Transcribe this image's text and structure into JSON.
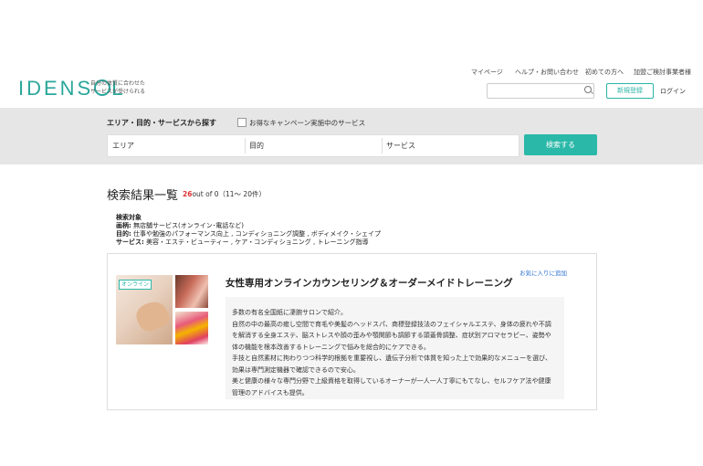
{
  "header": {
    "logo_text_left": "IDENS",
    "logo_text_right": "L",
    "tagline_line1": "自分の体質に合わせた",
    "tagline_line2": "サービスが受けられる",
    "nav": [
      "マイページ",
      "ヘルプ・お問い合わせ",
      "初めての方へ",
      "加盟ご検討事業者様"
    ],
    "search_placeholder": "",
    "register_label": "新規登録",
    "login_label": "ログイン"
  },
  "search": {
    "title": "エリア・目的・サービスから探す",
    "campaign_label": "お得なキャンペーン実施中のサービス",
    "fields": [
      "エリア",
      "目的",
      "サービス"
    ],
    "button_label": "検索する"
  },
  "results": {
    "title": "検索結果一覧",
    "count_number": "26",
    "count_suffix": "out of 0（11〜 20件）",
    "target_heading": "検索対象",
    "target_lines": [
      {
        "label": "画柄:",
        "value": " 無店舗サービス(オンライン･電話など)"
      },
      {
        "label": "目的:",
        "value": " 仕事や勉強のパフォーマンス向上 , コンディショニング調整 , ボディメイク・シェイプ"
      },
      {
        "label": "サービス:",
        "value": " 美容・エステ・ビューティー , ケア・コンディショニング , トレーニング指導"
      }
    ]
  },
  "card": {
    "favorite_label": "お気に入りに追加",
    "badge": "オンライン",
    "title": "女性専用オンラインカウンセリング＆オーダーメイドトレーニング",
    "description": [
      "多数の有名全国紙に凄腕サロンで紹介。",
      "自然の中の最高の癒し空間で育毛や美髪のヘッドスパ、商標登録技法のフェイシャルエステ、身体の疲れや不調",
      "を解消する全身エステ、脳ストレスや顔の歪みや顎関節も調節する頭蓋骨調整、症状別アロマセラピー、姿勢や",
      "体の機能を根本改善するトレーニングで悩みを総合的にケアできる。",
      "手技と自然素材に拘わりつつ科学的根拠を重要視し、遺伝子分析で体質を知った上で効果的なメニューを選び、",
      "効果は専門測定機器で確認できるので安心。",
      "美と健康の様々な専門分野で上級資格を取得しているオーナーが一人一人丁寧にもてなし、セルフケア法や健康",
      "管理のアドバイスも提供。"
    ]
  },
  "colors": {
    "accent": "#2ab8a8",
    "count_highlight": "#e03030",
    "link": "#2a6fcf",
    "search_band": "#e6e6e6"
  }
}
